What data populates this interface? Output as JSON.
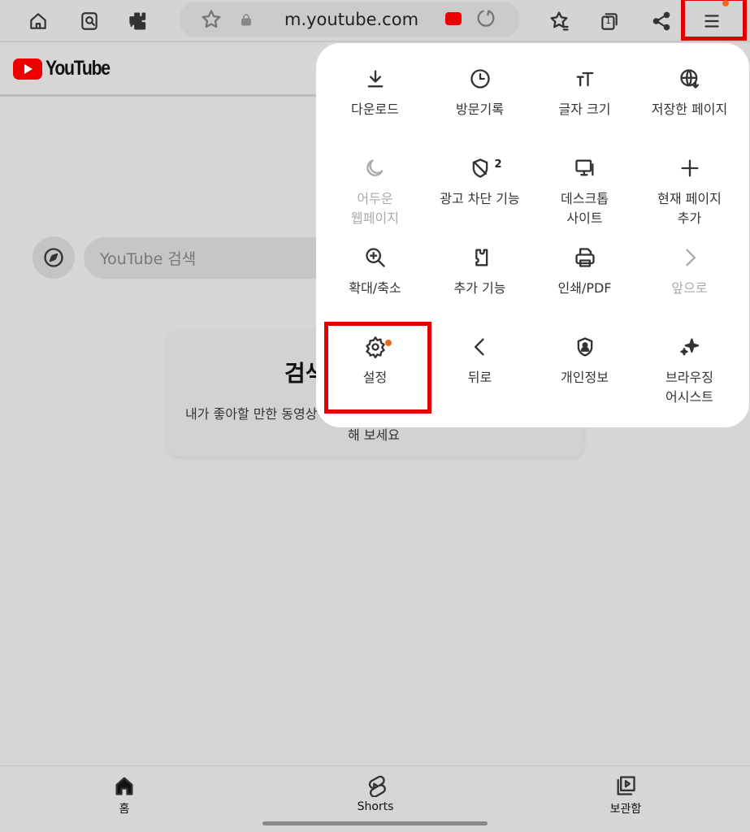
{
  "browser": {
    "url": "m.youtube.com",
    "tab_count": "1",
    "accent": "#f06a1a",
    "highlight": "#e00000"
  },
  "page": {
    "brand": "YouTube",
    "search_placeholder": "YouTube 검색",
    "card_title": "검색",
    "card_desc": "내가 좋아할 만한 동영상",
    "card_desc2": "해 보세요"
  },
  "menu": {
    "items": [
      {
        "label": "다운로드",
        "icon": "download-icon"
      },
      {
        "label": "방문기록",
        "icon": "clock-icon"
      },
      {
        "label": "글자 크기",
        "icon": "text-size-icon"
      },
      {
        "label": "저장한 페이지",
        "icon": "saved-page-icon"
      },
      {
        "label": "어두운\n웹페이지",
        "icon": "moon-icon",
        "disabled": true
      },
      {
        "label": "광고 차단 기능",
        "icon": "shield-icon",
        "badge": "2"
      },
      {
        "label": "데스크톱\n사이트",
        "icon": "desktop-icon"
      },
      {
        "label": "현재 페이지\n추가",
        "icon": "plus-icon"
      },
      {
        "label": "확대/축소",
        "icon": "zoom-icon"
      },
      {
        "label": "추가 기능",
        "icon": "puzzle-icon"
      },
      {
        "label": "인쇄/PDF",
        "icon": "print-icon"
      },
      {
        "label": "앞으로",
        "icon": "chevron-right-icon",
        "disabled": true
      },
      {
        "label": "설정",
        "icon": "gear-icon",
        "highlighted": true
      },
      {
        "label": "뒤로",
        "icon": "chevron-left-icon"
      },
      {
        "label": "개인정보",
        "icon": "privacy-shield-icon"
      },
      {
        "label": "브라우징\n어시스트",
        "icon": "sparkle-icon"
      }
    ]
  },
  "bottom_nav": {
    "home": "홈",
    "shorts": "Shorts",
    "library": "보관함"
  }
}
